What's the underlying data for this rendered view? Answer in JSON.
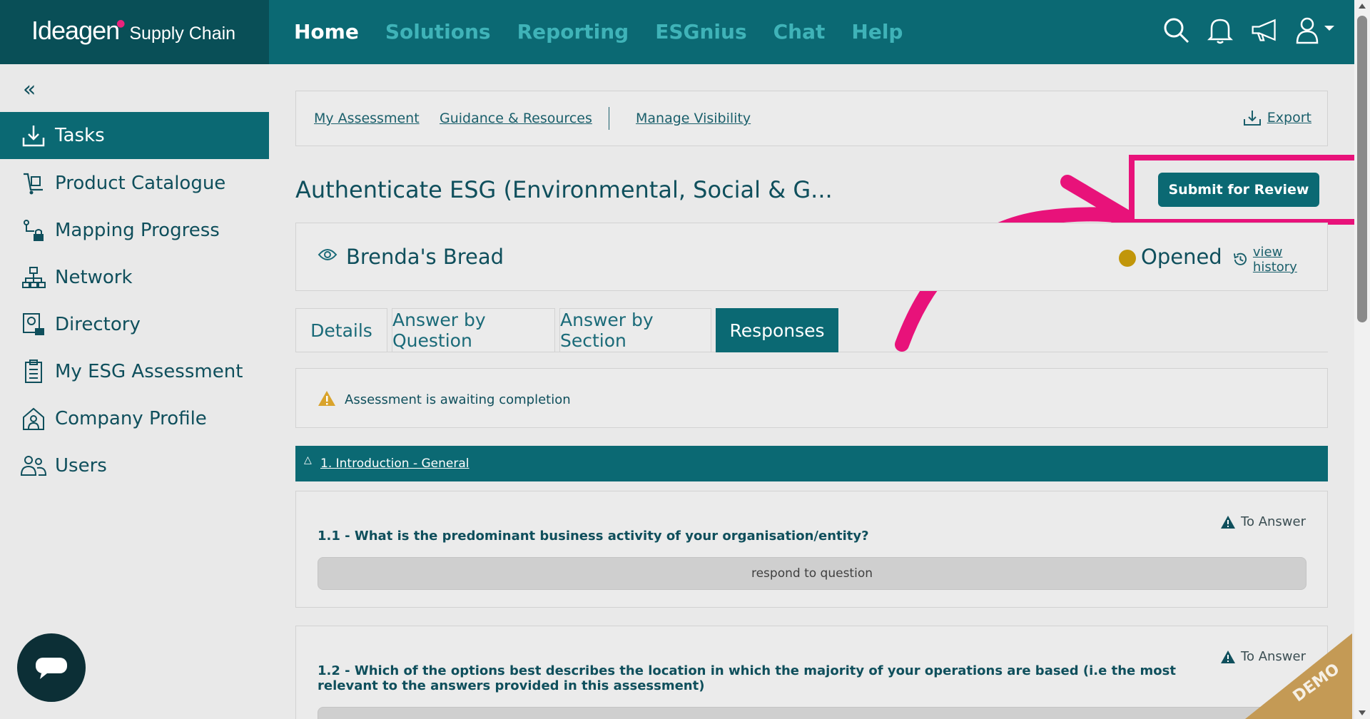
{
  "brand": {
    "name": "Ideagen",
    "product": "Supply Chain"
  },
  "topnav": {
    "items": [
      "Home",
      "Solutions",
      "Reporting",
      "ESGnius",
      "Chat",
      "Help"
    ],
    "active": "Home"
  },
  "top_icons": [
    "search-icon",
    "bell-icon",
    "megaphone-icon",
    "user-icon"
  ],
  "sidebar": {
    "items": [
      {
        "label": "Tasks",
        "icon": "tray-download-icon",
        "active": true
      },
      {
        "label": "Product Catalogue",
        "icon": "trolley-icon"
      },
      {
        "label": "Mapping Progress",
        "icon": "mapping-lock-icon"
      },
      {
        "label": "Network",
        "icon": "network-icon"
      },
      {
        "label": "Directory",
        "icon": "directory-lock-icon"
      },
      {
        "label": "My ESG Assessment",
        "icon": "clipboard-icon"
      },
      {
        "label": "Company Profile",
        "icon": "house-person-icon"
      },
      {
        "label": "Users",
        "icon": "users-icon"
      }
    ]
  },
  "linkbar": {
    "my_assessment": "My Assessment",
    "guidance": "Guidance & Resources",
    "manage_visibility": "Manage Visibility",
    "export": "Export"
  },
  "page": {
    "title": "Authenticate ESG (Environmental, Social & G...",
    "submit_label": "Submit for Review"
  },
  "supplier": {
    "name": "Brenda's Bread",
    "status": "Opened",
    "view_history": "view history"
  },
  "tabs": [
    "Details",
    "Answer by Question",
    "Answer by Section",
    "Responses"
  ],
  "active_tab": "Responses",
  "notice": "Assessment is awaiting completion",
  "section": {
    "title": "1. Introduction - General"
  },
  "questions": [
    {
      "text": "1.1 - What is the predominant business activity of your organisation/entity?",
      "status": "To Answer",
      "action": "respond to question"
    },
    {
      "text": "1.2 - Which of the options best describes the location in which the majority of your operations are based (i.e the most relevant to the answers provided in this assessment)",
      "status": "To Answer"
    }
  ],
  "watermark": "DEMO",
  "colors": {
    "primary": "#0b6973",
    "accent": "#e8127a",
    "status": "#c1960a"
  }
}
